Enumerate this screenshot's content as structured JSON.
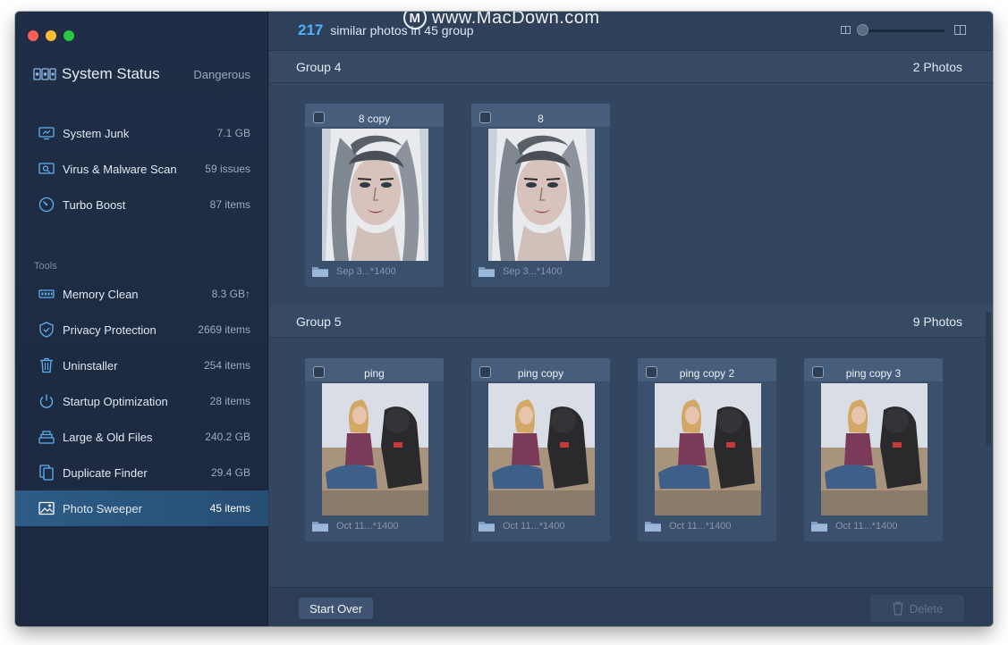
{
  "watermark": {
    "logo": "M",
    "text": "www.MacDown.com"
  },
  "sidebar": {
    "status_title": "System Status",
    "status_state": "Dangerous",
    "tools_heading": "Tools",
    "items": [
      {
        "icon": "monitor-icon",
        "label": "System Junk",
        "value": "7.1 GB"
      },
      {
        "icon": "virus-scan-icon",
        "label": "Virus & Malware Scan",
        "value": "59 issues"
      },
      {
        "icon": "speedometer-icon",
        "label": "Turbo Boost",
        "value": "87 items"
      },
      {
        "icon": "memory-chip-icon",
        "label": "Memory Clean",
        "value": "8.3 GB↑"
      },
      {
        "icon": "shield-icon",
        "label": "Privacy Protection",
        "value": "2669 items"
      },
      {
        "icon": "trash-icon",
        "label": "Uninstaller",
        "value": "254 items"
      },
      {
        "icon": "power-icon",
        "label": "Startup Optimization",
        "value": "28 items"
      },
      {
        "icon": "stack-icon",
        "label": "Large & Old Files",
        "value": "240.2 GB"
      },
      {
        "icon": "duplicate-icon",
        "label": "Duplicate Finder",
        "value": "29.4 GB"
      },
      {
        "icon": "photo-icon",
        "label": "Photo Sweeper",
        "value": "45 items"
      }
    ],
    "active_item": "Photo Sweeper"
  },
  "header": {
    "count": "217",
    "summary_text": "similar photos in 45 group"
  },
  "groups": [
    {
      "title": "Group 4",
      "count_label": "2 Photos",
      "photos": [
        {
          "name": "8 copy",
          "meta": "Sep 3...*1400",
          "kind": "portrait"
        },
        {
          "name": "8",
          "meta": "Sep 3...*1400",
          "kind": "portrait"
        }
      ]
    },
    {
      "title": "Group 5",
      "count_label": "9 Photos",
      "photos": [
        {
          "name": "ping",
          "meta": "Oct 11...*1400",
          "kind": "dog"
        },
        {
          "name": "ping copy",
          "meta": "Oct 11...*1400",
          "kind": "dog"
        },
        {
          "name": "ping copy 2",
          "meta": "Oct 11...*1400",
          "kind": "dog"
        },
        {
          "name": "ping copy 3",
          "meta": "Oct 11...*1400",
          "kind": "dog"
        }
      ]
    }
  ],
  "footer": {
    "start_over_label": "Start Over",
    "delete_label": "Delete"
  },
  "colors": {
    "accent": "#4db3ff",
    "sidebar_active": "#2d5c86",
    "close": "#fe5f57",
    "minimize": "#febc2e",
    "maximize": "#28c840"
  }
}
